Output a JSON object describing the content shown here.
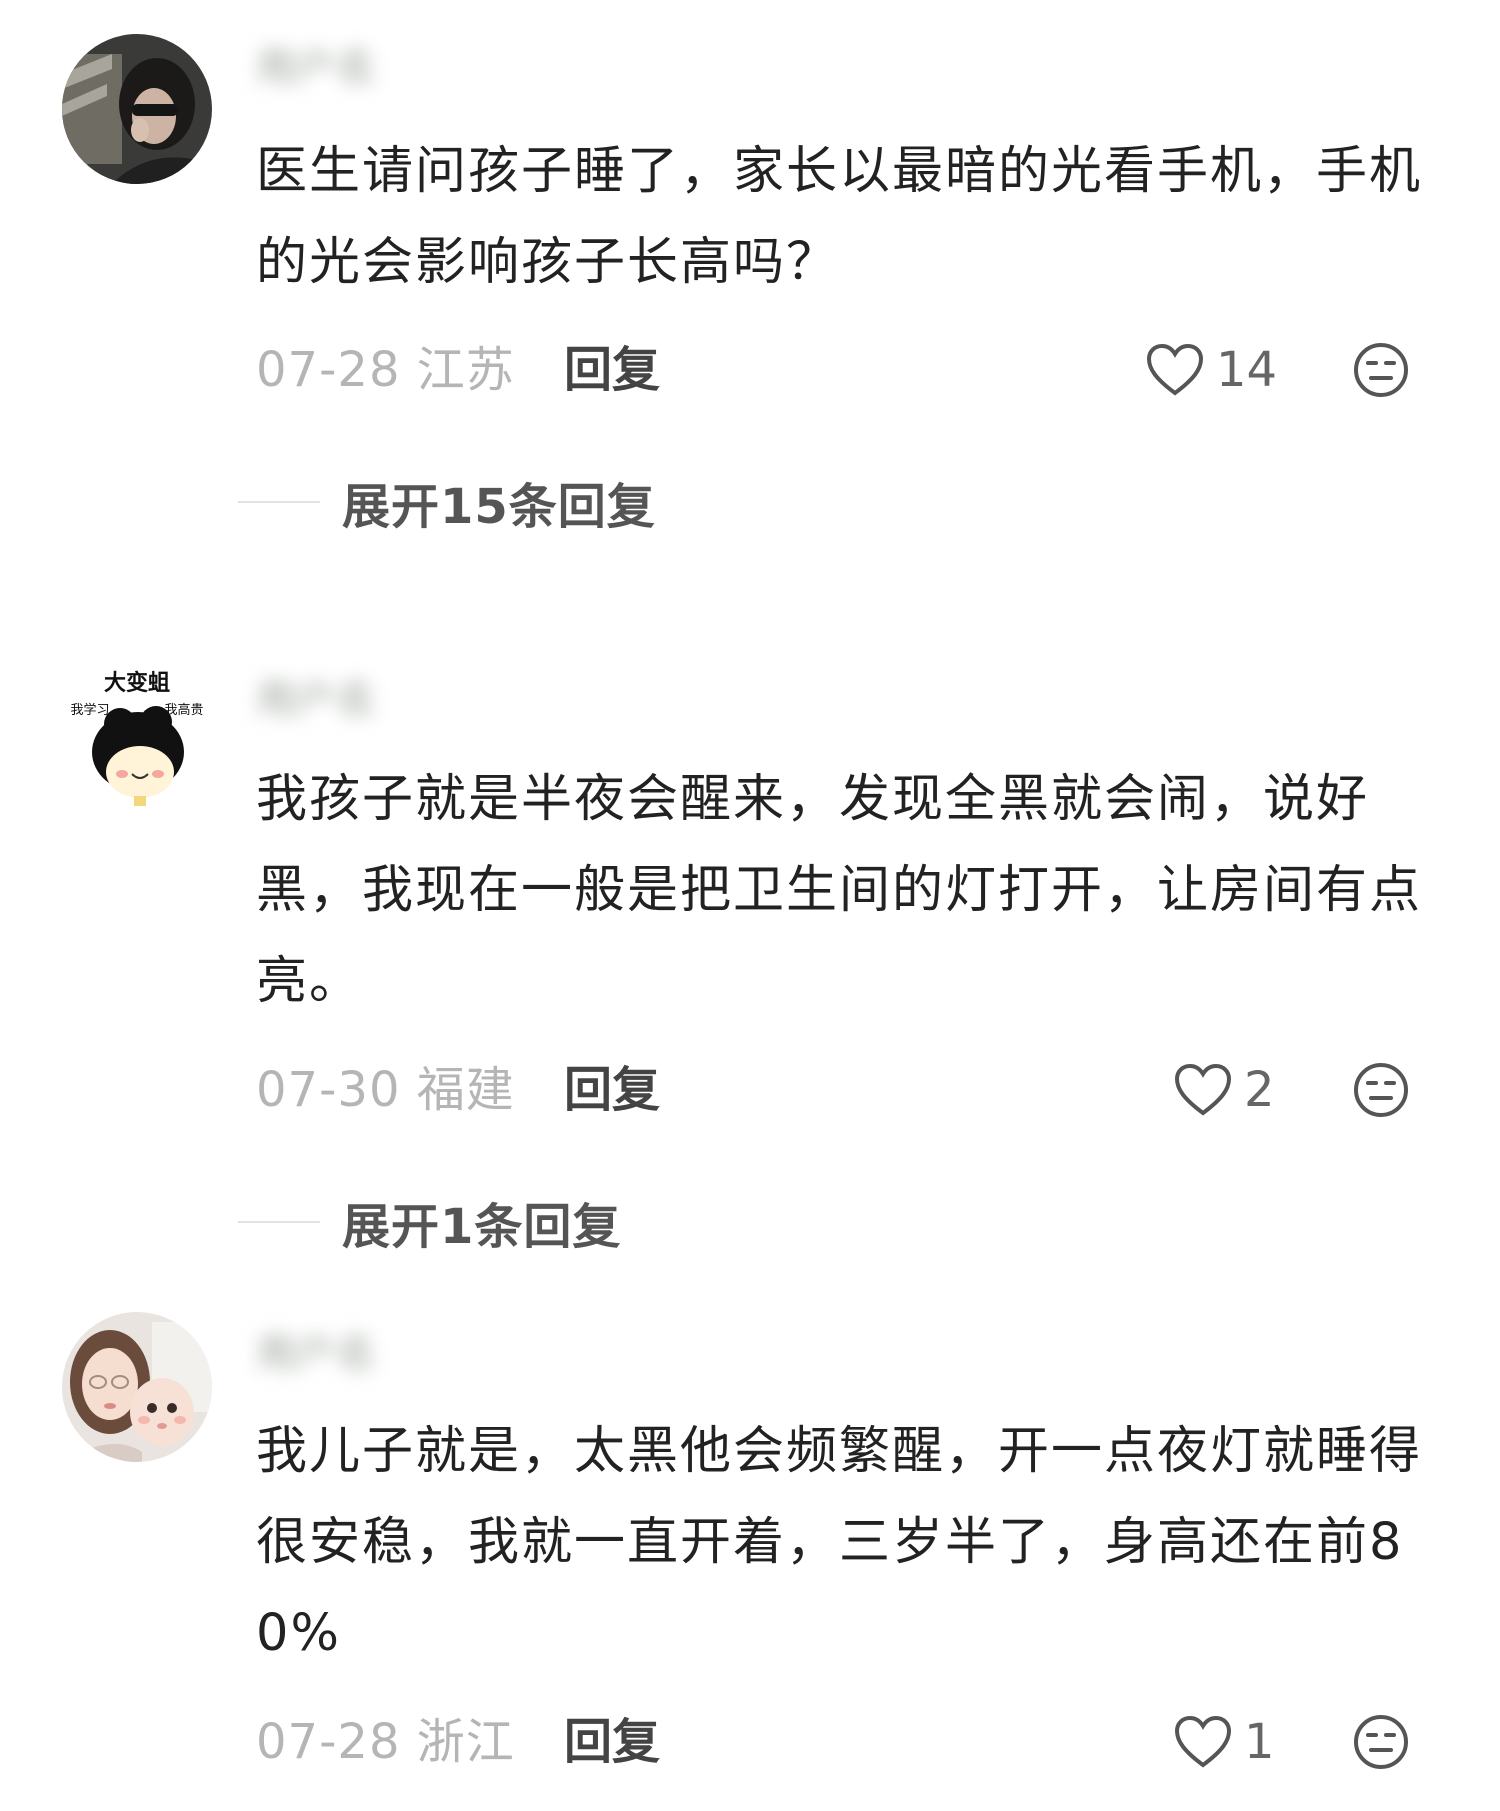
{
  "comments": [
    {
      "username": "用户名",
      "text": "医生请问孩子睡了，家长以最暗的光看手机，手机的光会影响孩子长高吗？",
      "date_region": "07-28 江苏",
      "reply_label": "回复",
      "likes": "14",
      "expand_label": "展开15条回复"
    },
    {
      "username": "用户名",
      "avatar_text_top": "大变蛆",
      "avatar_text_left": "我学习",
      "avatar_text_right": "我高贵",
      "text": "我孩子就是半夜会醒来，发现全黑就会闹，说好黑，我现在一般是把卫生间的灯打开，让房间有点亮。",
      "date_region": "07-30 福建",
      "reply_label": "回复",
      "likes": "2",
      "expand_label": "展开1条回复"
    },
    {
      "username": "用户名",
      "text": "我儿子就是，太黑他会频繁醒，开一点夜灯就睡得很安稳，我就一直开着，三岁半了，身高还在前80%",
      "date_region": "07-28 浙江",
      "reply_label": "回复",
      "likes": "1"
    }
  ],
  "icons": {
    "like": "heart-outline-icon",
    "emoji": "neutral-face-icon"
  },
  "colors": {
    "text": "#222222",
    "meta": "#b5b5b5",
    "reply": "#444444",
    "expand": "#555555"
  }
}
